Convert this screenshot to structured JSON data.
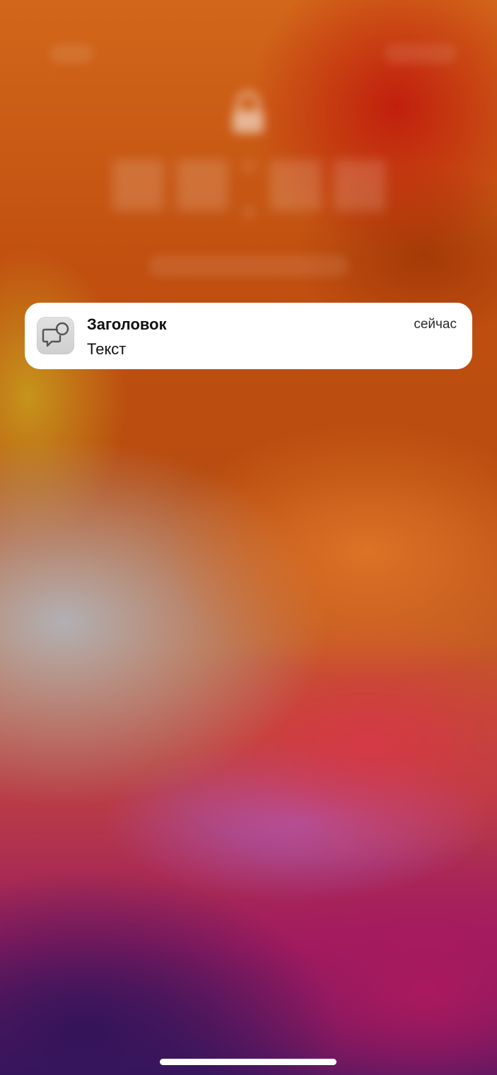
{
  "notification": {
    "app_icon": "chat-bubble-badge-icon",
    "title": "Заголовок",
    "body": "Текст",
    "time": "сейчас"
  },
  "lock_screen": {
    "background_icon": "lock-icon"
  }
}
